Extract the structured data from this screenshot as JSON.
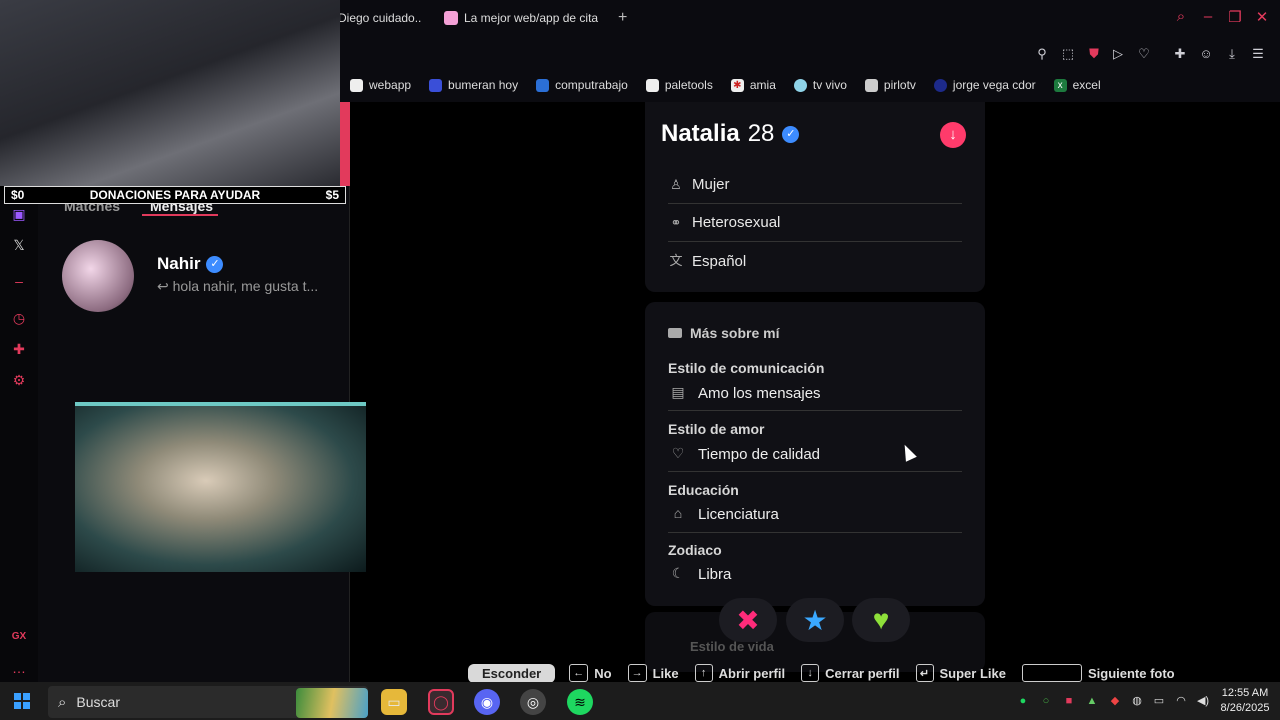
{
  "browser": {
    "tabs": [
      {
        "label": "Diego cuidado.."
      },
      {
        "label": "La mejor web/app de cita"
      }
    ],
    "new_tab": "+",
    "bookmarks": [
      "webapp",
      "bumeran hoy",
      "computrabajo",
      "paletools",
      "amia",
      "tv vivo",
      "pirlotv",
      "jorge vega cdor",
      "excel"
    ]
  },
  "overlay": {
    "left_amount": "$0",
    "center_text": "DONACIONES PARA AYUDAR",
    "right_amount": "$5"
  },
  "left_panel": {
    "tabs": [
      "Matches",
      "Mensajes"
    ],
    "conversation": {
      "name": "Nahir",
      "preview": "hola nahir, me gusta t..."
    }
  },
  "profile": {
    "name": "Natalia",
    "age": "28",
    "basics": [
      {
        "icon": "person-icon",
        "label": "Mujer"
      },
      {
        "icon": "orientation-icon",
        "label": "Heterosexual"
      },
      {
        "icon": "language-icon",
        "label": "Español"
      }
    ],
    "more_title": "Más sobre mí",
    "details": [
      {
        "label": "Estilo de comunicación",
        "value": "Amo los mensajes",
        "icon": "chat-icon"
      },
      {
        "label": "Estilo de amor",
        "value": "Tiempo de calidad",
        "icon": "heart-chat-icon"
      },
      {
        "label": "Educación",
        "value": "Licenciatura",
        "icon": "graduation-cap-icon"
      },
      {
        "label": "Zodiaco",
        "value": "Libra",
        "icon": "moon-icon"
      }
    ],
    "next_section": "Estilo de vida"
  },
  "hints": {
    "hide": "Esconder",
    "no": "No",
    "like": "Like",
    "open_profile": "Abrir perfil",
    "close_profile": "Cerrar perfil",
    "super_like": "Super Like",
    "next_photo": "Siguiente foto"
  },
  "taskbar": {
    "search": "Buscar",
    "time": "12:55 AM",
    "date": "8/26/2025"
  },
  "colors": {
    "accent": "#e23a5c",
    "dislike": "#ff2b7a",
    "superlike": "#3aa8ff",
    "like": "#8ee03a"
  }
}
